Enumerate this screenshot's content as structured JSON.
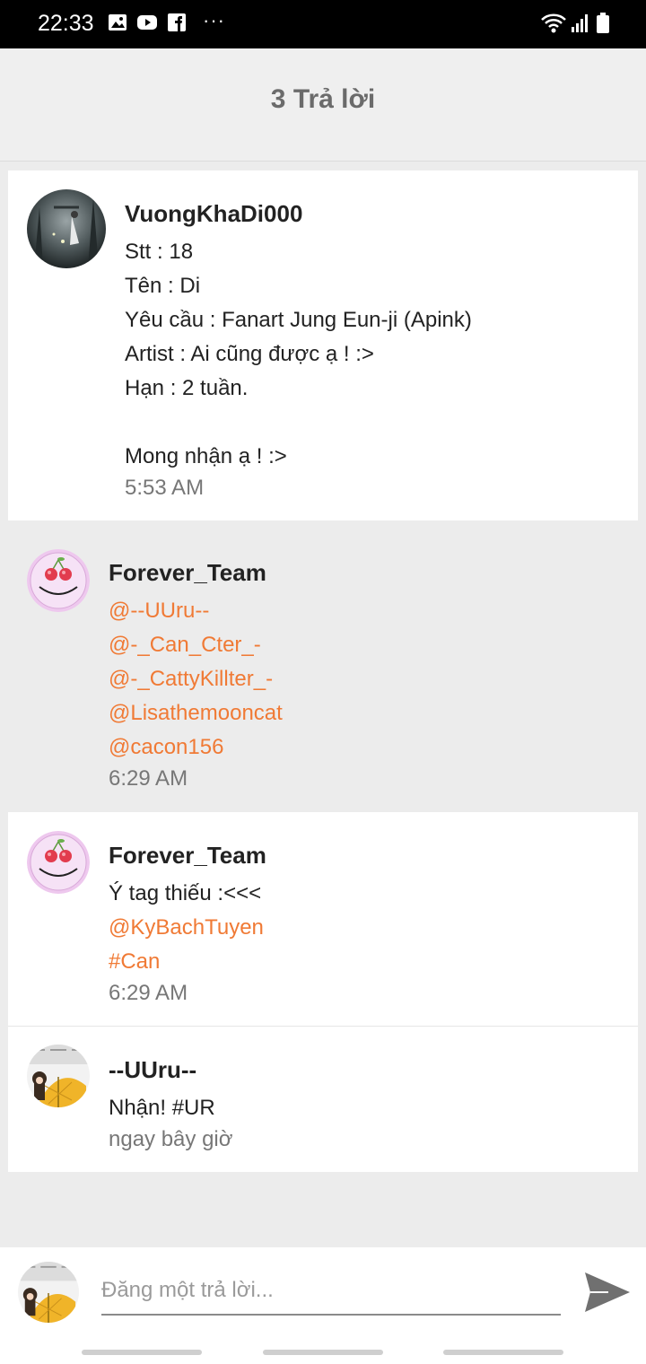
{
  "status_bar": {
    "time": "22:33",
    "more": "···",
    "icons": [
      "gallery-icon",
      "youtube-icon",
      "facebook-icon",
      "wifi-icon",
      "signal-icon",
      "battery-icon"
    ]
  },
  "header": {
    "title": "3 Trả lời"
  },
  "comments": [
    {
      "author": "VuongKhaDi000",
      "lines": [
        "Stt : 18",
        "Tên : Di",
        "Yêu cầu : Fanart Jung Eun-ji (Apink)",
        "Artist : Ai cũng được ạ ! :>",
        "Hạn : 2 tuần.",
        "",
        "Mong nhận ạ ! :>"
      ],
      "time": "5:53 AM"
    },
    {
      "author": "Forever_Team",
      "mentions": [
        "@--UUru--",
        "@-_Can_Cter_-",
        "@-_CattyKillter_-",
        "@Lisathemooncat",
        "@cacon156"
      ],
      "time": "6:29 AM"
    },
    {
      "author": "Forever_Team",
      "text": "Ý tag thiếu :<<<",
      "mentions": [
        "@KyBachTuyen",
        "#Can"
      ],
      "time": "6:29 AM"
    },
    {
      "author": "--UUru--",
      "text": "Nhận! #UR",
      "time": "ngay bây giờ"
    }
  ],
  "reply": {
    "placeholder": "Đăng một trả lời..."
  },
  "colors": {
    "mention": "#f07a35",
    "header_text": "#6b6b6b",
    "background": "#ececec"
  }
}
